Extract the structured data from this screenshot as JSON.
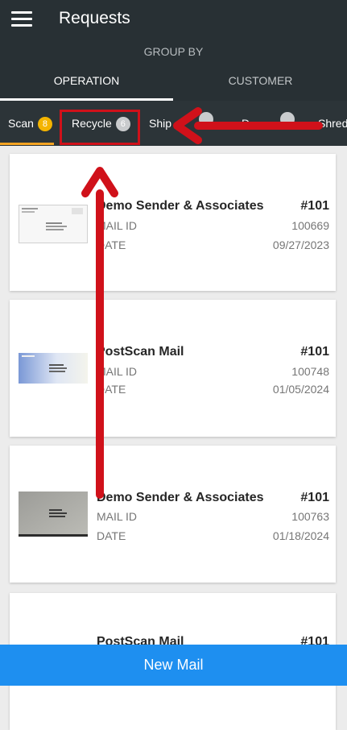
{
  "header": {
    "title": "Requests"
  },
  "group_by": {
    "label": "GROUP BY",
    "tabs": [
      "OPERATION",
      "CUSTOMER"
    ]
  },
  "operations": [
    {
      "label": "Scan",
      "count": "8",
      "active": true
    },
    {
      "label": "Recycle",
      "count": "6"
    },
    {
      "label": "Ship",
      "count": ""
    },
    {
      "label": "D",
      "count": ""
    },
    {
      "label": "Shred",
      "count": ""
    }
  ],
  "cards": [
    {
      "sender": "Demo Sender & Associates",
      "number": "#101",
      "id_label": "MAIL ID",
      "id": "100669",
      "date_label": "DATE",
      "date": "09/27/2023"
    },
    {
      "sender": "PostScan Mail",
      "number": "#101",
      "id_label": "MAIL ID",
      "id": "100748",
      "date_label": "DATE",
      "date": "01/05/2024"
    },
    {
      "sender": "Demo Sender & Associates",
      "number": "#101",
      "id_label": "MAIL ID",
      "id": "100763",
      "date_label": "DATE",
      "date": "01/18/2024"
    },
    {
      "sender": "PostScan Mail",
      "number": "#101"
    }
  ],
  "footer": {
    "new_mail": "New Mail"
  },
  "colors": {
    "appbar": "#283034",
    "accent_orange": "#f4a321",
    "annotation_red": "#d0111a",
    "primary_blue": "#1e8ff0"
  }
}
